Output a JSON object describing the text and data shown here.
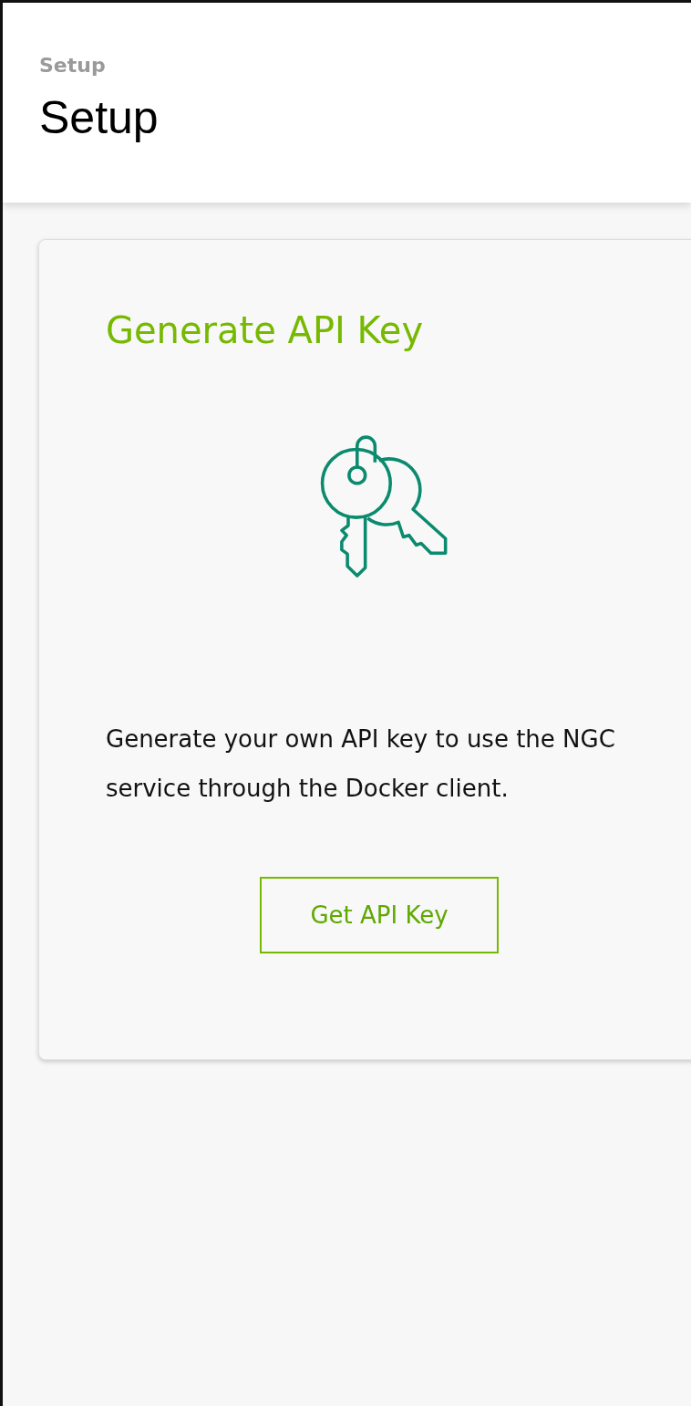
{
  "header": {
    "breadcrumb": "Setup",
    "title": "Setup"
  },
  "card": {
    "title": "Generate API Key",
    "description": "Generate your own API key to use the NGC service through the Docker client.",
    "button": "Get API Key"
  }
}
